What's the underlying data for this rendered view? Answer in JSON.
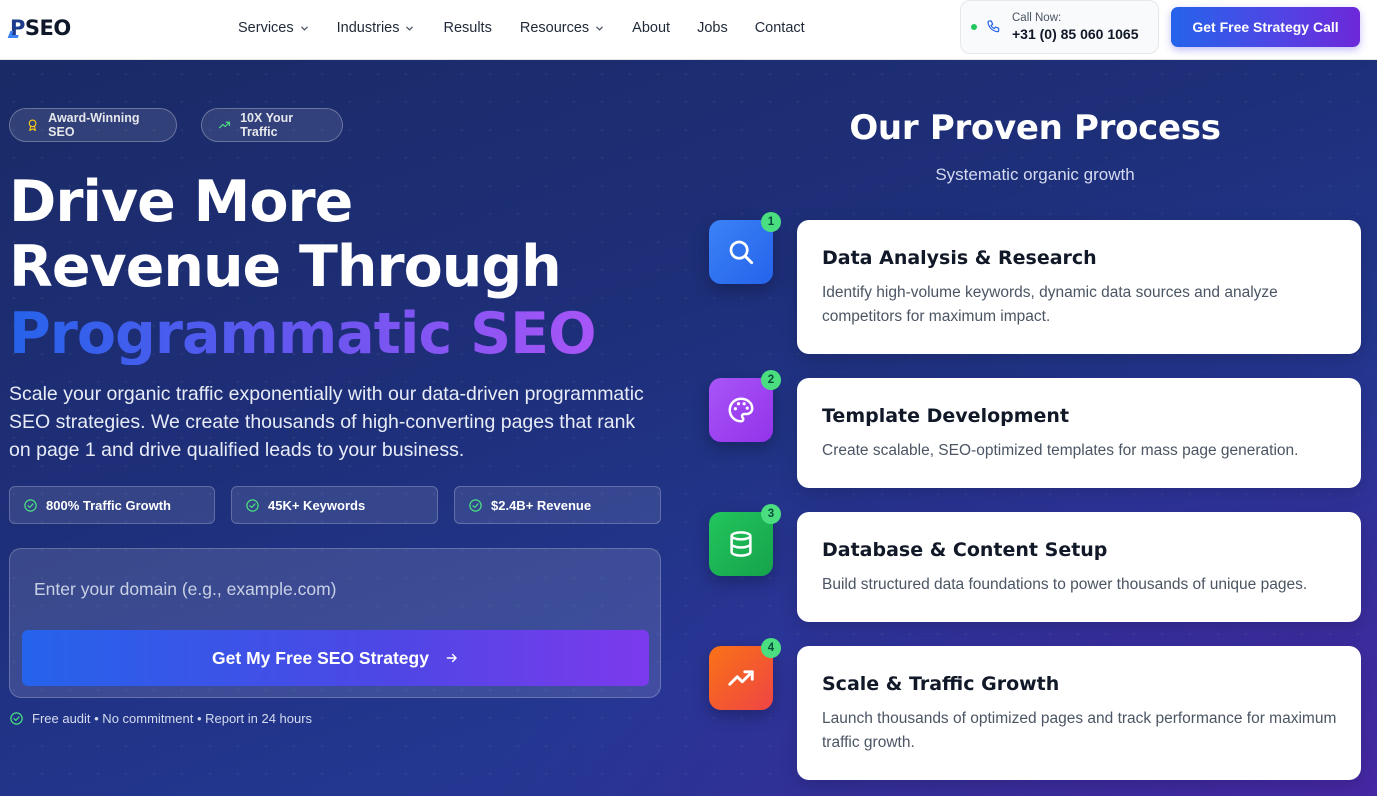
{
  "header": {
    "logo_text": "PSEO",
    "nav": [
      {
        "label": "Services",
        "has_dropdown": true
      },
      {
        "label": "Industries",
        "has_dropdown": true
      },
      {
        "label": "Results",
        "has_dropdown": false
      },
      {
        "label": "Resources",
        "has_dropdown": true
      },
      {
        "label": "About",
        "has_dropdown": false
      },
      {
        "label": "Jobs",
        "has_dropdown": false
      },
      {
        "label": "Contact",
        "has_dropdown": false
      }
    ],
    "call_label": "Call Now:",
    "call_number": "+31 (0) 85 060 1065",
    "cta_label": "Get Free Strategy Call"
  },
  "hero": {
    "badges": [
      {
        "label": "Award-Winning SEO",
        "icon": "award-icon"
      },
      {
        "label": "10X Your Traffic",
        "icon": "trending-up-icon"
      }
    ],
    "headline_line1": "Drive More",
    "headline_line2": "Revenue Through",
    "headline_highlight": "Programmatic SEO",
    "subtext": "Scale your organic traffic exponentially with our data-driven programmatic SEO strategies. We create thousands of high-converting pages that rank on page 1 and drive qualified leads to your business.",
    "stats": [
      {
        "label": "800% Traffic Growth"
      },
      {
        "label": "45K+ Keywords"
      },
      {
        "label": "$2.4B+ Revenue"
      }
    ],
    "domain_placeholder": "Enter your domain (e.g., example.com)",
    "domain_value": "",
    "cta_label": "Get My Free SEO Strategy",
    "note": "Free audit • No commitment • Report in 24 hours"
  },
  "process": {
    "title": "Our Proven Process",
    "subtitle": "Systematic organic growth",
    "steps": [
      {
        "number": "1",
        "title": "Data Analysis & Research",
        "description": "Identify high-volume keywords, dynamic data sources and analyze competitors for maximum impact.",
        "icon": "search-icon",
        "color": "#3b82f6"
      },
      {
        "number": "2",
        "title": "Template Development",
        "description": "Create scalable, SEO-optimized templates for mass page generation.",
        "icon": "palette-icon",
        "color": "#a855f7"
      },
      {
        "number": "3",
        "title": "Database & Content Setup",
        "description": "Build structured data foundations to power thousands of unique pages.",
        "icon": "database-icon",
        "color": "#22c55e"
      },
      {
        "number": "4",
        "title": "Scale & Traffic Growth",
        "description": "Launch thousands of optimized pages and track performance for maximum traffic growth.",
        "icon": "trending-up-icon",
        "color": "#f97316"
      }
    ]
  },
  "colors": {
    "accent_blue": "#2563eb",
    "accent_purple": "#7c3aed",
    "hero_bg": "#1e2f7a",
    "success_green": "#4ade80"
  }
}
